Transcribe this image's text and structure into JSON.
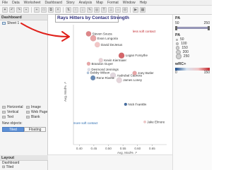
{
  "menu": [
    "File",
    "Data",
    "Worksheet",
    "Dashboard",
    "Story",
    "Analysis",
    "Map",
    "Format",
    "Window",
    "Help"
  ],
  "left_panel": {
    "header": "Dashboard",
    "sheet": "Sheet 1",
    "objects": [
      "Horizontal",
      "Image",
      "Vertical",
      "Web Page",
      "Text",
      "Blank"
    ],
    "new_objects_label": "New objects:",
    "tiled": "Tiled",
    "floating": "Floating",
    "layout_header": "Layout",
    "layout_dashboard": "Dashboard",
    "layout_tiled": "Tiled"
  },
  "chart": {
    "title": "Rays Hitters by Contact Strength",
    "less_soft": "less soft contact",
    "more_soft": "more soft contact",
    "xlabel": "Avg. Mod% ↗",
    "ylabel": "Avg. Mod% ↗"
  },
  "legend": {
    "pa_title": "PA",
    "pa_min": "50",
    "pa_max": "250",
    "pa_size_title": "PA",
    "pa_sizes": [
      "50",
      "100",
      "150",
      "200",
      "250"
    ],
    "wrc_title": "wRC+",
    "wrc_min": "0",
    "wrc_max": "150"
  },
  "colors": {
    "accent_red": "#c0262c",
    "accent_blue": "#1f4e8c",
    "title_blue": "#2a2a7a"
  },
  "chart_data": {
    "type": "scatter",
    "title": "Rays Hitters by Contact Strength",
    "xlabel": "Avg. Mod%",
    "ylabel": "Avg. Mod%",
    "xlim": [
      0.38,
      0.7
    ],
    "ylim": [
      0.2,
      0.95
    ],
    "x_ticks": [
      "0.40",
      "0.45",
      "0.50",
      "0.55",
      "0.60",
      "0.65"
    ],
    "points": [
      {
        "name": "Steven Souza",
        "x": 0.432,
        "y": 0.893,
        "pa": 200,
        "wrc": 120
      },
      {
        "name": "Evan Longoria",
        "x": 0.448,
        "y": 0.865,
        "pa": 240,
        "wrc": 110
      },
      {
        "name": "David DeJesus",
        "x": 0.462,
        "y": 0.825,
        "pa": 200,
        "wrc": 100
      },
      {
        "name": "Logan Forsythe",
        "x": 0.545,
        "y": 0.757,
        "pa": 230,
        "wrc": 130
      },
      {
        "name": "Kevin Kiermaier",
        "x": 0.474,
        "y": 0.728,
        "pa": 150,
        "wrc": 80
      },
      {
        "name": "Brandon Guyer",
        "x": 0.432,
        "y": 0.706,
        "pa": 120,
        "wrc": 110
      },
      {
        "name": "Desmond Jennings",
        "x": 0.433,
        "y": 0.669,
        "pa": 80,
        "wrc": 60
      },
      {
        "name": "Bobby Wilson",
        "x": 0.43,
        "y": 0.649,
        "pa": 60,
        "wrc": 40
      },
      {
        "name": "Asdrubal Cabrera",
        "x": 0.516,
        "y": 0.633,
        "pa": 220,
        "wrc": 70
      },
      {
        "name": "Joey Butler",
        "x": 0.59,
        "y": 0.647,
        "pa": 150,
        "wrc": 110
      },
      {
        "name": "Rene Rivera",
        "x": 0.447,
        "y": 0.617,
        "pa": 180,
        "wrc": 20
      },
      {
        "name": "James Loney",
        "x": 0.537,
        "y": 0.603,
        "pa": 220,
        "wrc": 75
      },
      {
        "name": "Nick Franklin",
        "x": 0.559,
        "y": 0.452,
        "pa": 80,
        "wrc": 10
      },
      {
        "name": "Jake Elmore",
        "x": 0.625,
        "y": 0.342,
        "pa": 60,
        "wrc": 100
      }
    ]
  }
}
